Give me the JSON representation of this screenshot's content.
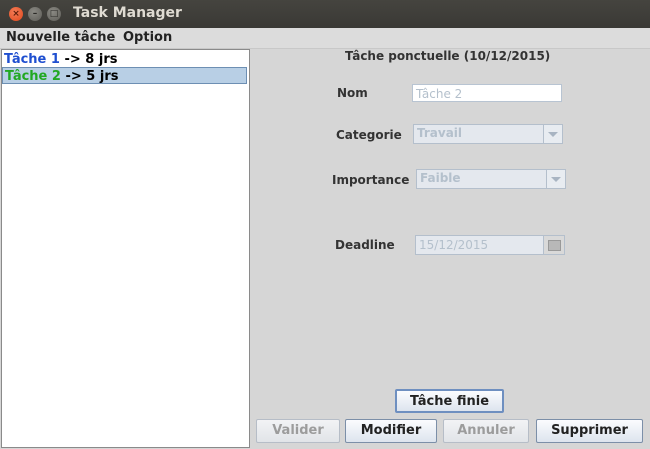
{
  "window": {
    "title": "Task Manager",
    "close_glyph": "×",
    "minimize_glyph": "–",
    "maximize_glyph": "□"
  },
  "menubar": {
    "items": [
      {
        "label": "Nouvelle tâche"
      },
      {
        "label": "Option"
      }
    ]
  },
  "task_list": {
    "items": [
      {
        "name": "Tâche 1",
        "name_color": "#1f4fd0",
        "duration": " -> 8 jrs",
        "selected": false
      },
      {
        "name": "Tâche 2",
        "name_color": "#22a822",
        "duration": " -> 5 jrs",
        "selected": true
      }
    ]
  },
  "detail": {
    "heading": "Tâche ponctuelle (10/12/2015)",
    "nom": {
      "label": "Nom",
      "value": "Tâche 2"
    },
    "categorie": {
      "label": "Categorie",
      "value": "Travail"
    },
    "importance": {
      "label": "Importance",
      "value": "Faible"
    },
    "deadline": {
      "label": "Deadline",
      "value": "15/12/2015"
    }
  },
  "buttons": {
    "finished": "Tâche finie",
    "validate": "Valider",
    "modify": "Modifier",
    "cancel": "Annuler",
    "delete": "Supprimer"
  },
  "icons": {
    "calendar": "calendar-icon",
    "dropdown": "chevron-down-icon"
  },
  "colors": {
    "selection_bg": "#b8cfe5",
    "titlebar": "#3c3b37",
    "close_button": "#e95420"
  }
}
